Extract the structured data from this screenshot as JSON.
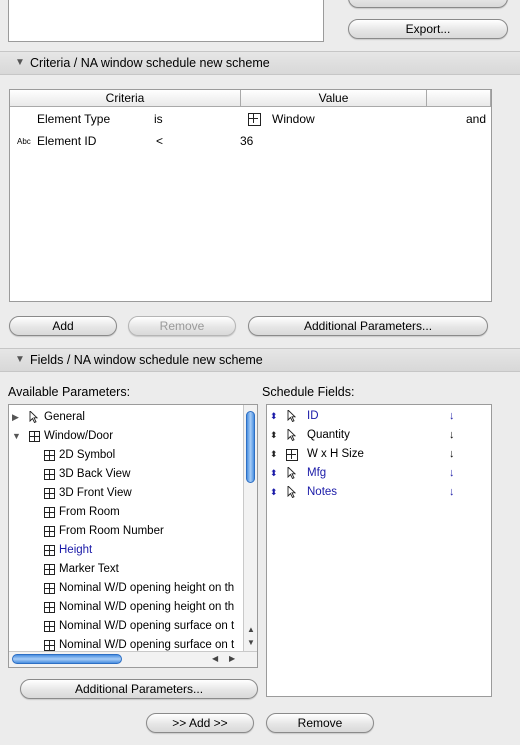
{
  "top_buttons": {
    "export_label": "Export..."
  },
  "criteria_section": {
    "title": "Criteria / NA window schedule new scheme",
    "columns": [
      "Criteria",
      "Value"
    ],
    "rows": [
      {
        "criteria": "Element Type",
        "operator": "is",
        "value": "Window",
        "join": "and",
        "icon": "window-icon"
      },
      {
        "criteria": "Element ID",
        "operator": "<",
        "value": "36",
        "join": "",
        "icon": "abc-text-icon",
        "icon_text": "Abc"
      }
    ],
    "add_label": "Add",
    "remove_label": "Remove",
    "additional_label": "Additional Parameters..."
  },
  "fields_section": {
    "title": "Fields / NA window schedule new scheme",
    "available_label": "Available Parameters:",
    "schedule_label": "Schedule Fields:",
    "available_items": [
      {
        "label": "General",
        "level": 0,
        "expanded": false,
        "icon": "cursor-icon",
        "highlight": false
      },
      {
        "label": "Window/Door",
        "level": 0,
        "expanded": true,
        "icon": "window-icon",
        "highlight": false
      },
      {
        "label": "2D Symbol",
        "level": 1,
        "icon": "window-icon",
        "highlight": false
      },
      {
        "label": "3D Back View",
        "level": 1,
        "icon": "window-icon",
        "highlight": false
      },
      {
        "label": "3D Front View",
        "level": 1,
        "icon": "window-icon",
        "highlight": false
      },
      {
        "label": "From Room",
        "level": 1,
        "icon": "window-icon",
        "highlight": false
      },
      {
        "label": "From Room Number",
        "level": 1,
        "icon": "window-icon",
        "highlight": false
      },
      {
        "label": "Height",
        "level": 1,
        "icon": "window-icon",
        "highlight": true
      },
      {
        "label": "Marker Text",
        "level": 1,
        "icon": "window-icon",
        "highlight": false
      },
      {
        "label": "Nominal W/D opening height on th",
        "level": 1,
        "icon": "window-icon",
        "highlight": false
      },
      {
        "label": "Nominal W/D opening height on th",
        "level": 1,
        "icon": "window-icon",
        "highlight": false
      },
      {
        "label": "Nominal W/D opening surface on t",
        "level": 1,
        "icon": "window-icon",
        "highlight": false
      },
      {
        "label": "Nominal W/D opening surface on t",
        "level": 1,
        "icon": "window-icon",
        "highlight": false
      }
    ],
    "schedule_items": [
      {
        "label": "ID",
        "icon": "cursor-icon",
        "highlight": true
      },
      {
        "label": "Quantity",
        "icon": "cursor-icon",
        "highlight": false
      },
      {
        "label": "W x H Size",
        "icon": "window-icon",
        "highlight": false
      },
      {
        "label": "Mfg",
        "icon": "cursor-icon",
        "highlight": true
      },
      {
        "label": "Notes",
        "icon": "cursor-icon",
        "highlight": true
      }
    ],
    "additional_label": "Additional Parameters...",
    "add_label": ">> Add >>",
    "remove_label": "Remove"
  },
  "colors": {
    "accent_blue": "#1a1aa8",
    "scroll_thumb": "#4a8fe0"
  }
}
